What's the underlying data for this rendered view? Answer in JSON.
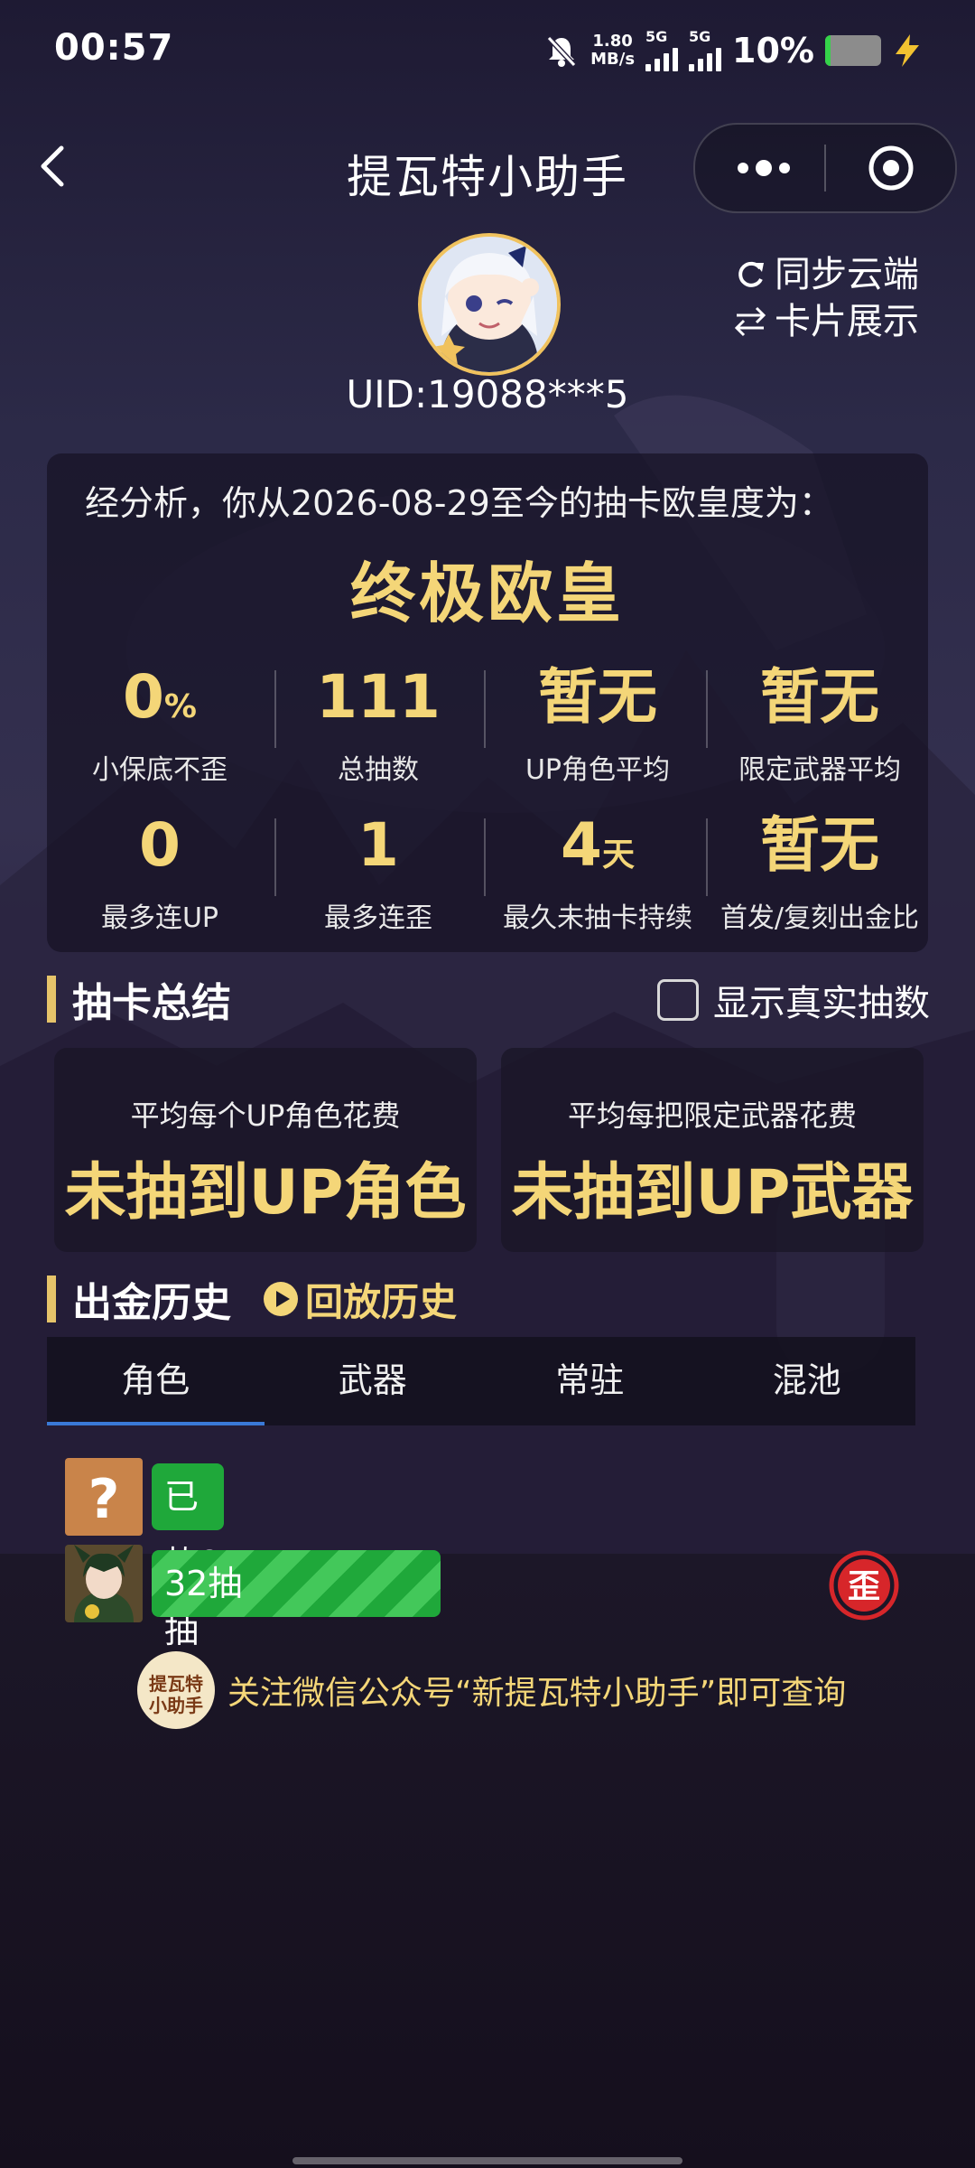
{
  "status_bar": {
    "time": "00:57",
    "speed_value": "1.80",
    "speed_unit": "MB/s",
    "sim1": "5G",
    "sim2": "5G",
    "battery_percent": "10%"
  },
  "nav": {
    "title": "提瓦特小助手"
  },
  "profile": {
    "uid": "UID:19088***5",
    "sync_label": "同步云端",
    "card_label": "卡片展示"
  },
  "stats": {
    "analysis_text": "经分析，你从2026-08-29至今的抽卡欧皇度为：",
    "verdict": "终极欧皇",
    "row1": [
      {
        "value": "0",
        "unit": "%",
        "label": "小保底不歪"
      },
      {
        "value": "111",
        "unit": "",
        "label": "总抽数"
      },
      {
        "value": "暂无",
        "unit": "",
        "label": "UP角色平均"
      },
      {
        "value": "暂无",
        "unit": "",
        "label": "限定武器平均"
      }
    ],
    "row2": [
      {
        "value": "0",
        "unit": "",
        "label": "最多连UP"
      },
      {
        "value": "1",
        "unit": "",
        "label": "最多连歪"
      },
      {
        "value": "4",
        "unit": "天",
        "label": "最久未抽卡持续"
      },
      {
        "value": "暂无",
        "unit": "",
        "label": "首发/复刻出金比"
      }
    ]
  },
  "summary": {
    "title": "抽卡总结",
    "show_real_label": "显示真实抽数",
    "cards": [
      {
        "label": "平均每个UP角色花费",
        "value": "未抽到UP角色"
      },
      {
        "label": "平均每把限定武器花费",
        "value": "未抽到UP武器"
      }
    ]
  },
  "history": {
    "title": "出金历史",
    "replay_label": "回放历史",
    "tabs": [
      "角色",
      "武器",
      "常驻",
      "混池"
    ],
    "active_tab": 0,
    "items": [
      {
        "text": "已垫8抽",
        "bar_fraction": 0.107
      },
      {
        "text": "32抽",
        "bar_fraction": 0.427,
        "badge": "歪"
      }
    ]
  },
  "footer": {
    "logo_line1": "提瓦特",
    "logo_line2": "小助手",
    "note": "关注微信公众号“新提瓦特小助手”即可查询"
  },
  "colors": {
    "accent_gold": "#f4d678",
    "bar_green": "#1fa83a",
    "tab_underline": "#3a79d7",
    "badge_red": "#d7262a"
  }
}
